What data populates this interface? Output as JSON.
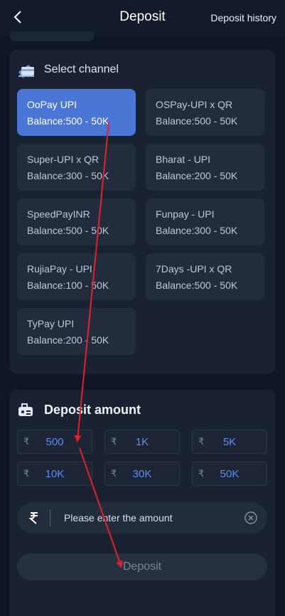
{
  "header": {
    "title": "Deposit",
    "history_label": "Deposit history"
  },
  "channel_section": {
    "title": "Select channel",
    "channels": [
      {
        "name": "OoPay UPI",
        "balance": "Balance:500 - 50K",
        "selected": true
      },
      {
        "name": "OSPay-UPI x QR",
        "balance": "Balance:500 - 50K",
        "selected": false
      },
      {
        "name": "Super-UPI x QR",
        "balance": "Balance:300 - 50K",
        "selected": false
      },
      {
        "name": "Bharat - UPI",
        "balance": "Balance:200 - 50K",
        "selected": false
      },
      {
        "name": "SpeedPayINR",
        "balance": "Balance:500 - 50K",
        "selected": false
      },
      {
        "name": "Funpay - UPI",
        "balance": "Balance:300 - 50K",
        "selected": false
      },
      {
        "name": "RujiaPay - UPI",
        "balance": "Balance:100 - 50K",
        "selected": false
      },
      {
        "name": "7Days -UPI x QR",
        "balance": "Balance:500 - 50K",
        "selected": false
      },
      {
        "name": "TyPay UPI",
        "balance": "Balance:200 - 50K",
        "selected": false
      }
    ]
  },
  "amount_section": {
    "title": "Deposit amount",
    "currency_symbol": "₹",
    "presets": [
      "500",
      "1K",
      "5K",
      "10K",
      "30K",
      "50K"
    ],
    "input_value": "",
    "input_placeholder": "Please enter the amount",
    "deposit_label": "Deposit"
  },
  "colors": {
    "background": "#0f1624",
    "card": "#1a2232",
    "selected_channel": "#4a76d6",
    "preset_text": "#5b8ff0",
    "annotation_arrow": "#e0222a"
  },
  "icons": {
    "back": "chevron-left-icon",
    "channel": "wallet-card-icon",
    "amount": "cash-machine-icon",
    "rupee": "rupee-icon",
    "clear": "close-circle-icon"
  }
}
